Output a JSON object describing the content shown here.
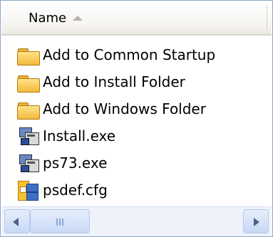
{
  "header": {
    "name_label": "Name",
    "sort_icon": "sort-ascending-icon"
  },
  "files": [
    {
      "label": "Add to Common Startup",
      "icon": "folder-icon"
    },
    {
      "label": "Add to Install Folder",
      "icon": "folder-icon"
    },
    {
      "label": "Add to Windows Folder",
      "icon": "folder-icon"
    },
    {
      "label": "Install.exe",
      "icon": "exe-icon"
    },
    {
      "label": "ps73.exe",
      "icon": "exe-icon"
    },
    {
      "label": "psdef.cfg",
      "icon": "config-file-icon"
    }
  ],
  "scrollbar": {
    "left_icon": "scroll-left-icon",
    "right_icon": "scroll-right-icon"
  },
  "colors": {
    "border": "#8ca5c9",
    "scroll_bg": "#eef3fb"
  }
}
